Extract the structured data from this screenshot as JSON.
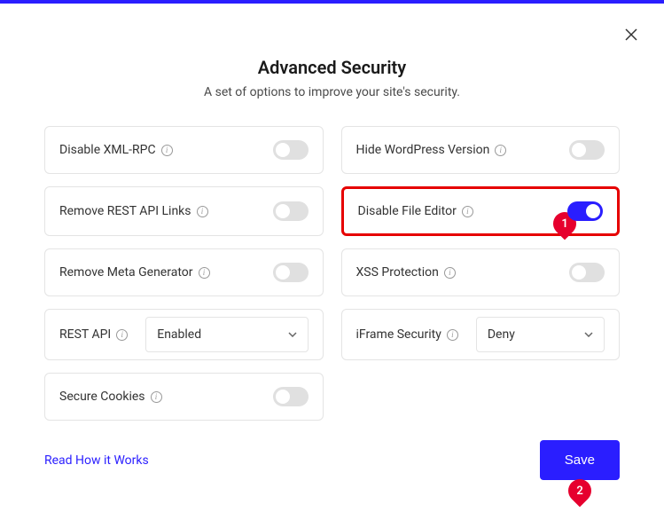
{
  "header": {
    "title": "Advanced Security",
    "subtitle": "A set of options to improve your site's security."
  },
  "options": {
    "disable_xmlrpc": {
      "label": "Disable XML-RPC",
      "on": false
    },
    "hide_wp_version": {
      "label": "Hide WordPress Version",
      "on": false
    },
    "remove_rest_links": {
      "label": "Remove REST API Links",
      "on": false
    },
    "disable_file_editor": {
      "label": "Disable File Editor",
      "on": true
    },
    "remove_meta_gen": {
      "label": "Remove Meta Generator",
      "on": false
    },
    "xss_protection": {
      "label": "XSS Protection",
      "on": false
    },
    "rest_api": {
      "label": "REST API",
      "value": "Enabled"
    },
    "iframe_security": {
      "label": "iFrame Security",
      "value": "Deny"
    },
    "secure_cookies": {
      "label": "Secure Cookies",
      "on": false
    }
  },
  "footer": {
    "link": "Read How it Works",
    "save": "Save"
  },
  "badges": {
    "b1": "1",
    "b2": "2"
  }
}
